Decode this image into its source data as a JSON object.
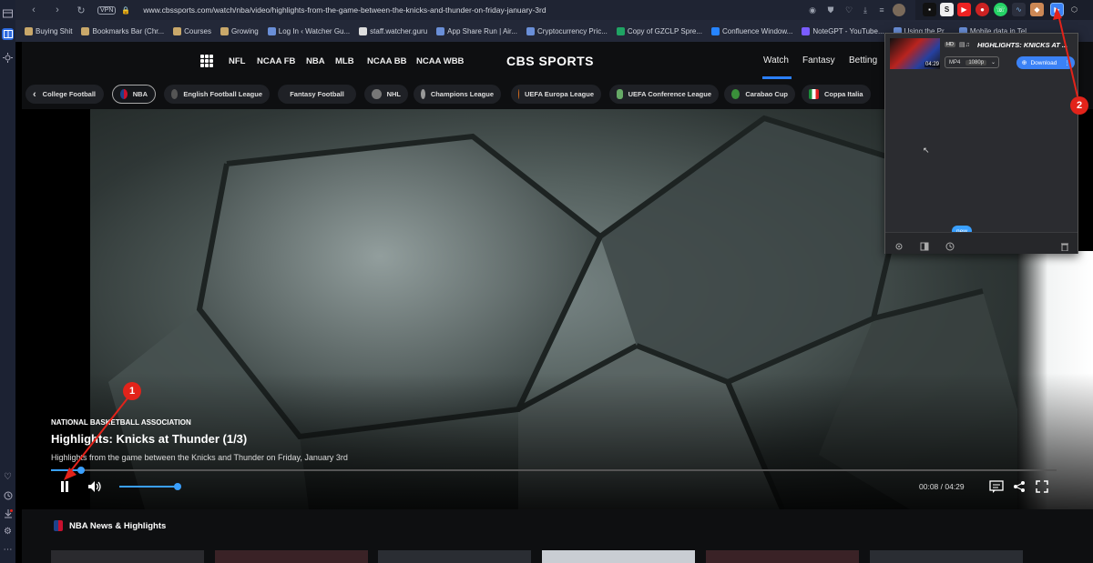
{
  "address_bar": {
    "vpn_label": "VPN",
    "url": "www.cbssports.com/watch/nba/video/highlights-from-the-game-between-the-knicks-and-thunder-on-friday-january-3rd"
  },
  "bookmarks": [
    {
      "label": "Buying Shit",
      "icon": "folder-icon"
    },
    {
      "label": "Bookmarks Bar (Chr...",
      "icon": "folder-icon"
    },
    {
      "label": "Courses",
      "icon": "folder-icon"
    },
    {
      "label": "Growing",
      "icon": "folder-icon"
    },
    {
      "label": "Log In ‹ Watcher Gu...",
      "icon": "site-icon"
    },
    {
      "label": "staff.watcher.guru",
      "icon": "r-icon"
    },
    {
      "label": "App Share Run | Air...",
      "icon": "site-icon"
    },
    {
      "label": "Cryptocurrency Pric...",
      "icon": "site-icon"
    },
    {
      "label": "Copy of GZCLP Spre...",
      "icon": "sheets-icon"
    },
    {
      "label": "Confluence Window...",
      "icon": "confluence-icon"
    },
    {
      "label": "NoteGPT - YouTube...",
      "icon": "notegpt-icon"
    },
    {
      "label": "Using the Pr...",
      "icon": "site-icon"
    },
    {
      "label": "Mobile data in Tel...",
      "icon": "site-icon"
    }
  ],
  "cbs_nav": {
    "left_links": [
      "NFL",
      "NCAA FB",
      "NBA",
      "MLB",
      "NCAA BB",
      "NCAA WBB"
    ],
    "logo": "CBS SPORTS",
    "right_links": [
      "Watch",
      "Fantasy",
      "Betting"
    ]
  },
  "leagues": [
    {
      "label": "College Football",
      "active": false
    },
    {
      "label": "NBA",
      "active": true
    },
    {
      "label": "English Football League",
      "active": false
    },
    {
      "label": "Fantasy Football",
      "active": false
    },
    {
      "label": "NHL",
      "active": false
    },
    {
      "label": "Champions League",
      "active": false
    },
    {
      "label": "UEFA Europa League",
      "active": false
    },
    {
      "label": "UEFA Conference League",
      "active": false
    },
    {
      "label": "Carabao Cup",
      "active": false
    },
    {
      "label": "Coppa Italia",
      "active": false
    }
  ],
  "video": {
    "org": "National Basketball Association",
    "title": "Highlights: Knicks at Thunder (1/3)",
    "description": "Highlights from the game between the Knicks and Thunder on Friday, January 3rd",
    "time_display": "00:08 / 04:29",
    "progress": 0.03,
    "volume": 1.0
  },
  "news_section": {
    "title": "NBA News & Highlights"
  },
  "extension_popup": {
    "item_title": "HIGHLIGHTS: KNICKS AT ...",
    "duration": "04:29",
    "hd_badge": "HD",
    "format": "MP4",
    "resolution": "1080p",
    "download_label": "Download",
    "new_badge": "new"
  },
  "annotations": [
    "1",
    "2"
  ],
  "colors": {
    "accent": "#3aa0ff",
    "badge": "#e2231a",
    "active_underline": "#2b7fff"
  }
}
